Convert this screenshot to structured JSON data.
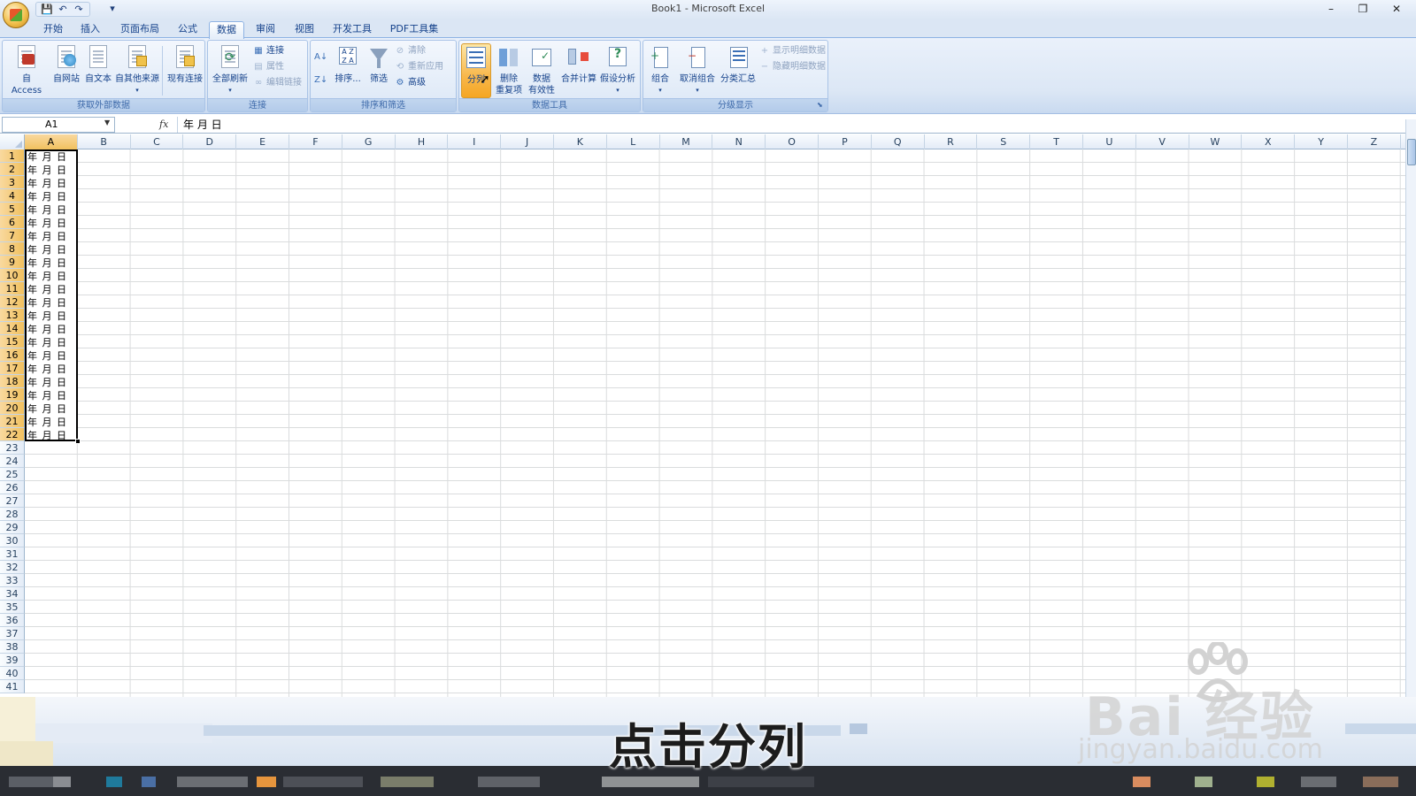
{
  "window": {
    "title": "Book1 - Microsoft Excel",
    "minimize": "–",
    "restore": "❐",
    "close": "✕"
  },
  "qat": {
    "save": "💾",
    "undo": "↶",
    "redo": "↷",
    "more": "▾"
  },
  "tabs": [
    {
      "label": "开始",
      "active": false
    },
    {
      "label": "插入",
      "active": false
    },
    {
      "label": "页面布局",
      "active": false
    },
    {
      "label": "公式",
      "active": false
    },
    {
      "label": "数据",
      "active": true
    },
    {
      "label": "审阅",
      "active": false
    },
    {
      "label": "视图",
      "active": false
    },
    {
      "label": "开发工具",
      "active": false
    },
    {
      "label": "PDF工具集",
      "active": false
    }
  ],
  "ribbon": {
    "get_external": {
      "label": "获取外部数据",
      "access": "自 Access",
      "web": "自网站",
      "text": "自文本",
      "other": "自其他来源",
      "existing": "现有连接"
    },
    "connections": {
      "label": "连接",
      "refresh_all": "全部刷新",
      "connections": "连接",
      "properties": "属性",
      "edit_links": "编辑链接"
    },
    "sort_filter": {
      "label": "排序和筛选",
      "sort": "排序...",
      "filter": "筛选",
      "clear": "清除",
      "reapply": "重新应用",
      "advanced": "高级"
    },
    "data_tools": {
      "label": "数据工具",
      "text_to_columns": "分列",
      "remove_dup_1": "删除",
      "remove_dup_2": "重复项",
      "validation_1": "数据",
      "validation_2": "有效性",
      "consolidate": "合并计算",
      "what_if": "假设分析"
    },
    "outline": {
      "label": "分级显示",
      "group": "组合",
      "ungroup": "取消组合",
      "subtotal": "分类汇总",
      "show_detail": "显示明细数据",
      "hide_detail": "隐藏明细数据"
    }
  },
  "formula_bar": {
    "name_box": "A1",
    "fx": "fx",
    "content": "年 月 日"
  },
  "columns": [
    "A",
    "B",
    "C",
    "D",
    "E",
    "F",
    "G",
    "H",
    "I",
    "J",
    "K",
    "L",
    "M",
    "N",
    "O",
    "P",
    "Q",
    "R",
    "S",
    "T",
    "U",
    "V",
    "W",
    "X",
    "Y",
    "Z"
  ],
  "rows": [
    "1",
    "2",
    "3",
    "4",
    "5",
    "6",
    "7",
    "8",
    "9",
    "10",
    "11",
    "12",
    "13",
    "14",
    "15",
    "16",
    "17",
    "18",
    "19",
    "20",
    "21",
    "22",
    "23",
    "24",
    "25",
    "26",
    "27",
    "28",
    "29",
    "30",
    "31",
    "32",
    "33",
    "34",
    "35",
    "36",
    "37",
    "38",
    "39",
    "40",
    "41"
  ],
  "column_a_values": [
    "年 月 日",
    "年 月 日",
    "年 月 日",
    "年 月 日",
    "年 月 日",
    "年 月 日",
    "年 月 日",
    "年 月 日",
    "年 月 日",
    "年 月 日",
    "年 月 日",
    "年 月 日",
    "年 月 日",
    "年 月 日",
    "年 月 日",
    "年 月 日",
    "年 月 日",
    "年 月 日",
    "年 月 日",
    "年 月 日",
    "年 月 日",
    "年 月 日"
  ],
  "selection": {
    "active_cell": "A1",
    "range_rows": 22
  },
  "subtitle": "点击分列",
  "watermark": {
    "brand": "Bai 经验",
    "url": "jingyan.baidu.com"
  },
  "colors": {
    "accent": "#15428b",
    "highlight": "#f8b74b",
    "ribbon_bg": "#dce7f5"
  }
}
